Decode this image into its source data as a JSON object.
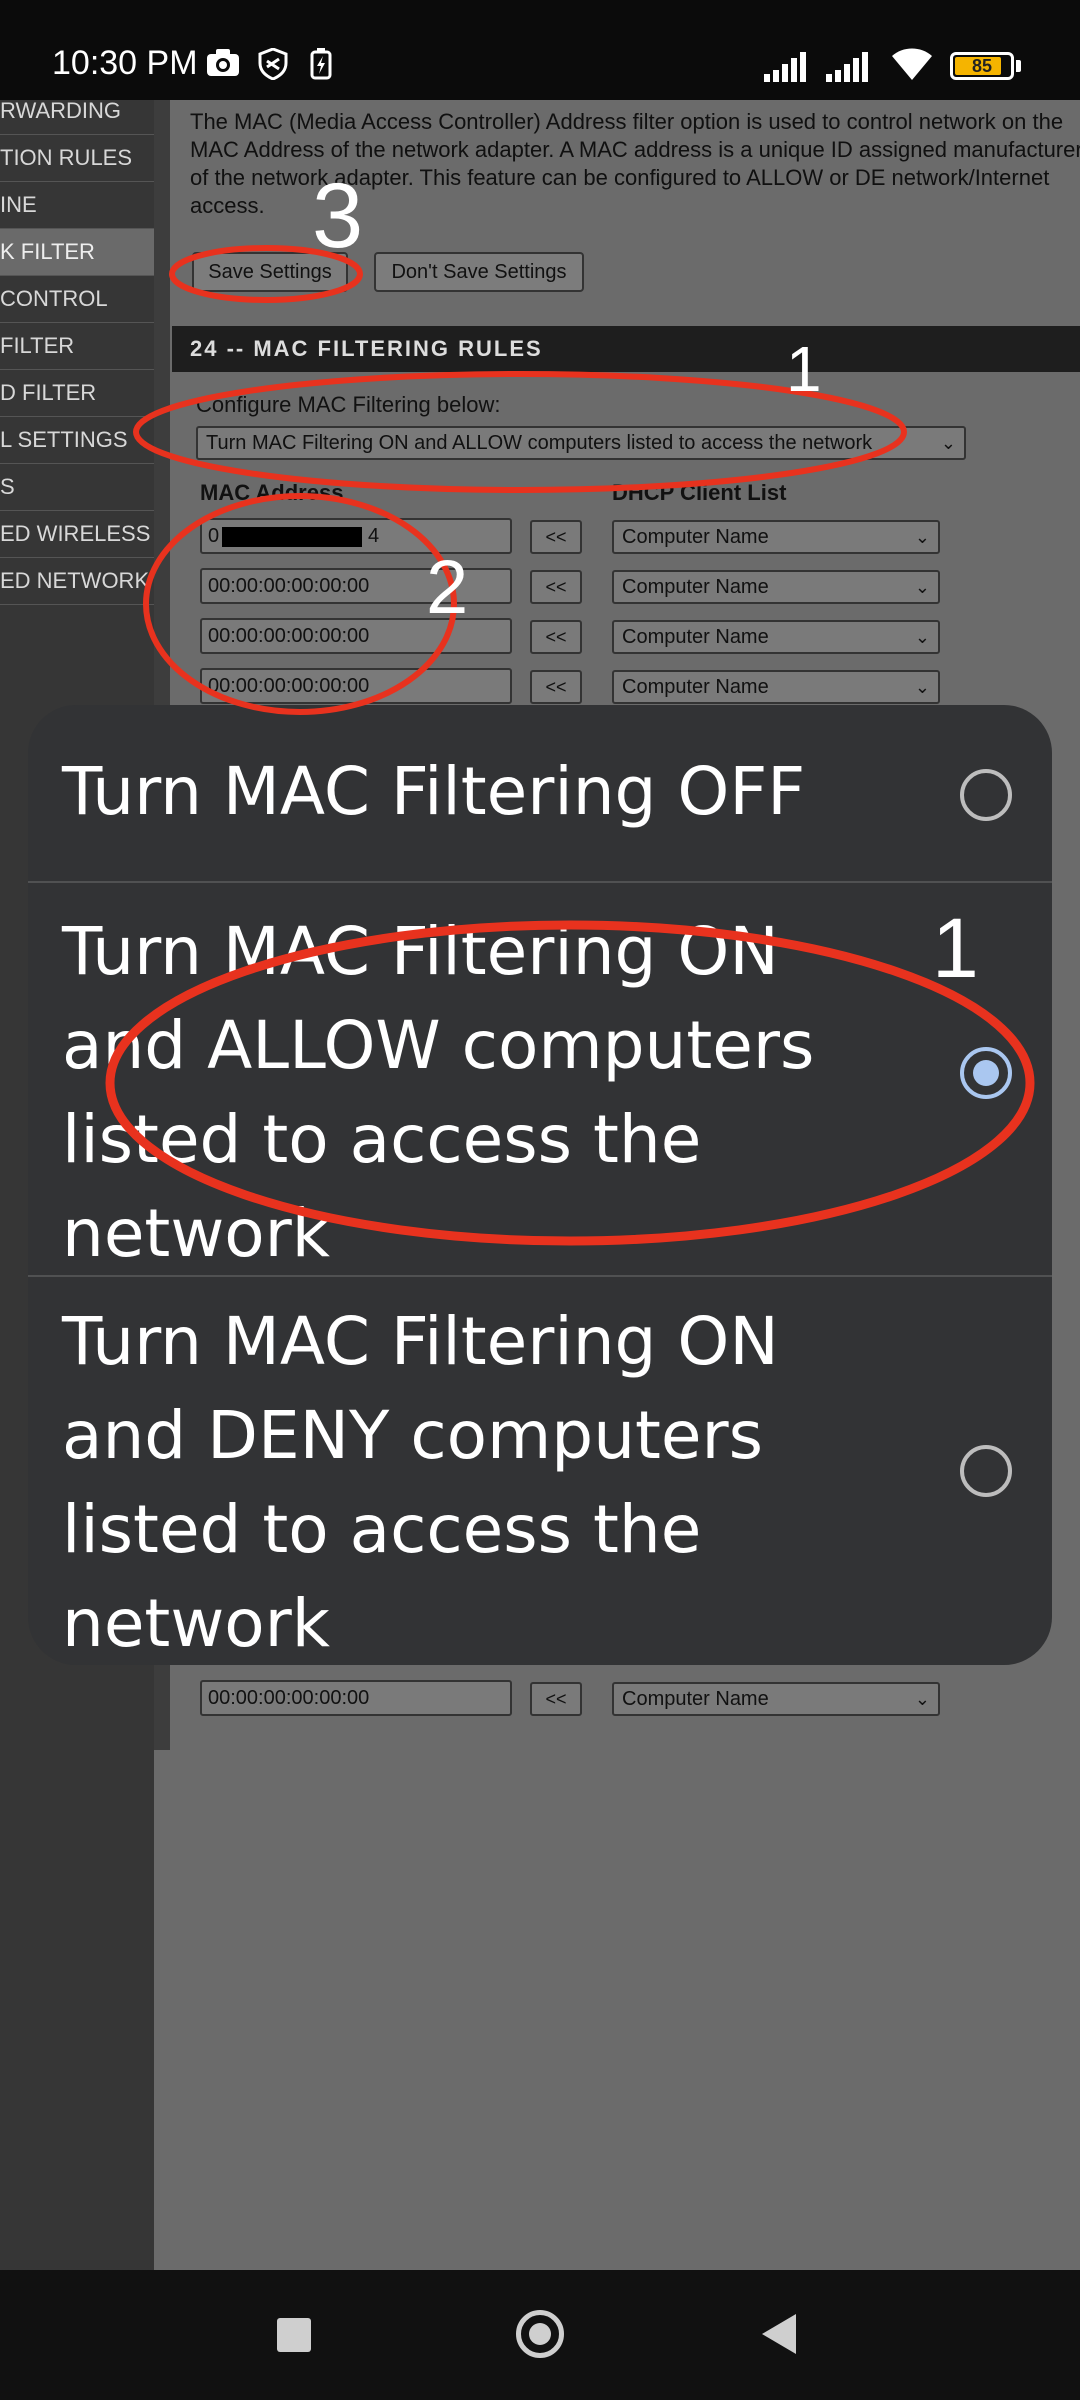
{
  "status_bar": {
    "time": "10:30 PM",
    "battery_level": "85",
    "icons": [
      "camera-icon",
      "shield-icon",
      "bolt-icon",
      "signal-icon",
      "signal-icon",
      "wifi-icon",
      "battery-icon"
    ]
  },
  "nav_menu": {
    "items": [
      {
        "label": "RWARDING",
        "active": false
      },
      {
        "label": "TION RULES",
        "active": false
      },
      {
        "label": "INE",
        "active": false
      },
      {
        "label": "K FILTER",
        "active": true
      },
      {
        "label": "CONTROL",
        "active": false
      },
      {
        "label": " FILTER",
        "active": false
      },
      {
        "label": "D FILTER",
        "active": false
      },
      {
        "label": "L SETTINGS",
        "active": false
      },
      {
        "label": "S",
        "active": false
      },
      {
        "label": "ED WIRELESS",
        "active": false
      },
      {
        "label": "ED NETWORK",
        "active": false
      }
    ]
  },
  "description": "The MAC (Media Access Controller) Address filter option is used to control network on the MAC Address of the network adapter. A MAC address is a unique ID assigned manufacturer of the network adapter. This feature can be configured to ALLOW or DE network/Internet access.",
  "buttons": {
    "save": "Save Settings",
    "dont_save": "Don't Save Settings"
  },
  "section": {
    "header": "24 -- MAC FILTERING RULES",
    "configure_label": "Configure MAC Filtering below:",
    "filter_select": "Turn MAC Filtering ON and ALLOW computers listed to access the network",
    "col_mac": "MAC Address",
    "col_dhcp": "DHCP Client List",
    "copy_label": "<<",
    "rows": [
      {
        "mac": "0",
        "mac_tail": "4",
        "redacted": true,
        "dhcp": "Computer Name"
      },
      {
        "mac": "00:00:00:00:00:00",
        "redacted": false,
        "dhcp": "Computer Name"
      },
      {
        "mac": "00:00:00:00:00:00",
        "redacted": false,
        "dhcp": "Computer Name"
      },
      {
        "mac": "00:00:00:00:00:00",
        "redacted": false,
        "dhcp": "Computer Name"
      },
      {
        "mac": "00:00:00:00:00:00",
        "redacted": false,
        "dhcp": "Computer Name"
      }
    ]
  },
  "annotations": {
    "marks": [
      "3",
      "1",
      "2",
      "1"
    ],
    "color": "#e8321e"
  },
  "dialog": {
    "options": [
      {
        "label": "Turn MAC Filtering OFF",
        "selected": false
      },
      {
        "label": "Turn MAC Filtering ON and ALLOW computers listed to access the network",
        "selected": true
      },
      {
        "label": "Turn MAC Filtering ON and DENY computers listed to access the network",
        "selected": false
      }
    ],
    "accent": "#aac7f0"
  },
  "navbar": {
    "buttons": [
      "recents-button",
      "home-button",
      "back-button"
    ]
  }
}
